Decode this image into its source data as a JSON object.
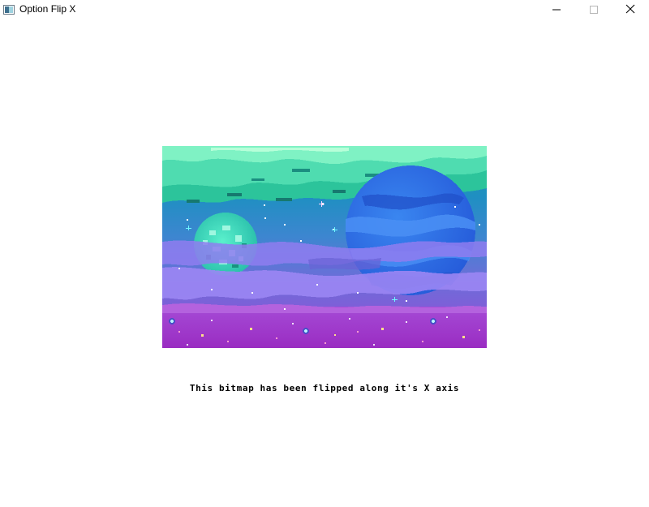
{
  "window": {
    "title": "Option Flip X",
    "minimize_icon": "minimize-icon",
    "maximize_icon": "maximize-icon",
    "close_icon": "close-icon"
  },
  "content": {
    "caption": "This bitmap has been flipped along it's X axis",
    "bitmap_subject": "pixel-art space scene"
  },
  "colors": {
    "sky_top": "#1c9ba8",
    "sky_mid": "#3d86d0",
    "sky_low": "#7e5fd8",
    "sky_bottom": "#9a35c8",
    "cloud_green": "#5fe3ae",
    "planet_blue": "#2b6fe8",
    "planet_teal": "#3fd9b8",
    "nebula_violet": "#8f7df0"
  }
}
